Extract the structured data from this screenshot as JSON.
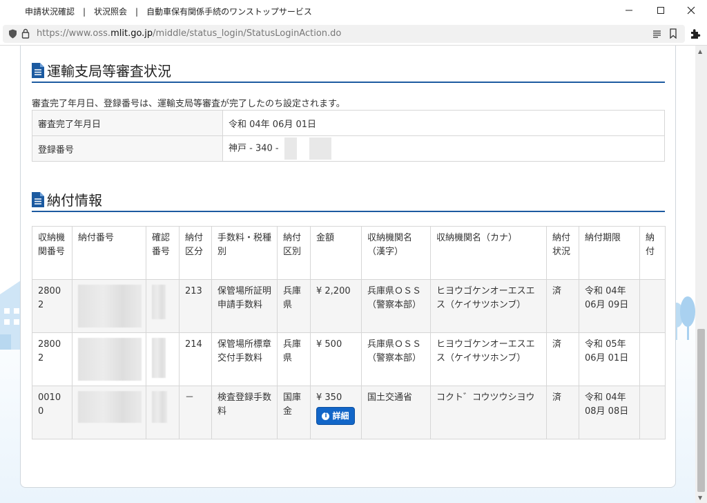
{
  "window": {
    "title": "申請状況確認　|　状況照会　|　自動車保有関係手続のワンストップサービス"
  },
  "address_bar": {
    "url_prefix": "https://www.oss.",
    "url_domain": "mlit.go.jp",
    "url_path": "/middle/status_login/StatusLoginAction.do"
  },
  "review": {
    "heading": "運輸支局等審査状況",
    "note": "審査完了年月日、登録番号は、運輸支局等審査が完了したのち設定されます。",
    "rows": [
      {
        "label": "審査完了年月日",
        "value": "令和 04年 06月 01日"
      },
      {
        "label": "登録番号",
        "value": "神戸 - 340 -"
      }
    ]
  },
  "payment": {
    "heading": "納付情報",
    "columns": [
      "収納機関番号",
      "納付番号",
      "確認番号",
      "納付区分",
      "手数料・税種別",
      "納付区別",
      "金額",
      "収納機関名（漢字）",
      "収納機関名（カナ）",
      "納付状況",
      "納付期限",
      "納付"
    ],
    "rows": [
      {
        "agency_no": "28002",
        "category": "213",
        "fee_type": "保管場所証明申請手数料",
        "division": "兵庫県",
        "amount": "¥ 2,200",
        "agency_kanji": "兵庫県ＯＳＳ（警察本部）",
        "agency_kana": "ヒヨウゴケンオーエスエス（ケイサツホンブ）",
        "status": "済",
        "deadline": "令和 04年 06月 09日"
      },
      {
        "agency_no": "28002",
        "category": "214",
        "fee_type": "保管場所標章交付手数料",
        "division": "兵庫県",
        "amount": "¥ 500",
        "agency_kanji": "兵庫県ＯＳＳ（警察本部）",
        "agency_kana": "ヒヨウゴケンオーエスエス（ケイサツホンブ）",
        "status": "済",
        "deadline": "令和 05年 06月 01日"
      },
      {
        "agency_no": "00100",
        "category": "－",
        "fee_type": "検査登録手数料",
        "division": "国庫金",
        "amount": "¥ 350",
        "agency_kanji": "国土交通省",
        "agency_kana": "コクト゛コウツウシヨウ",
        "status": "済",
        "deadline": "令和 04年 08月 08日"
      }
    ],
    "detail_button": "詳細"
  },
  "colors": {
    "heading_rule": "#1c5aa0",
    "button": "#1266c8"
  }
}
